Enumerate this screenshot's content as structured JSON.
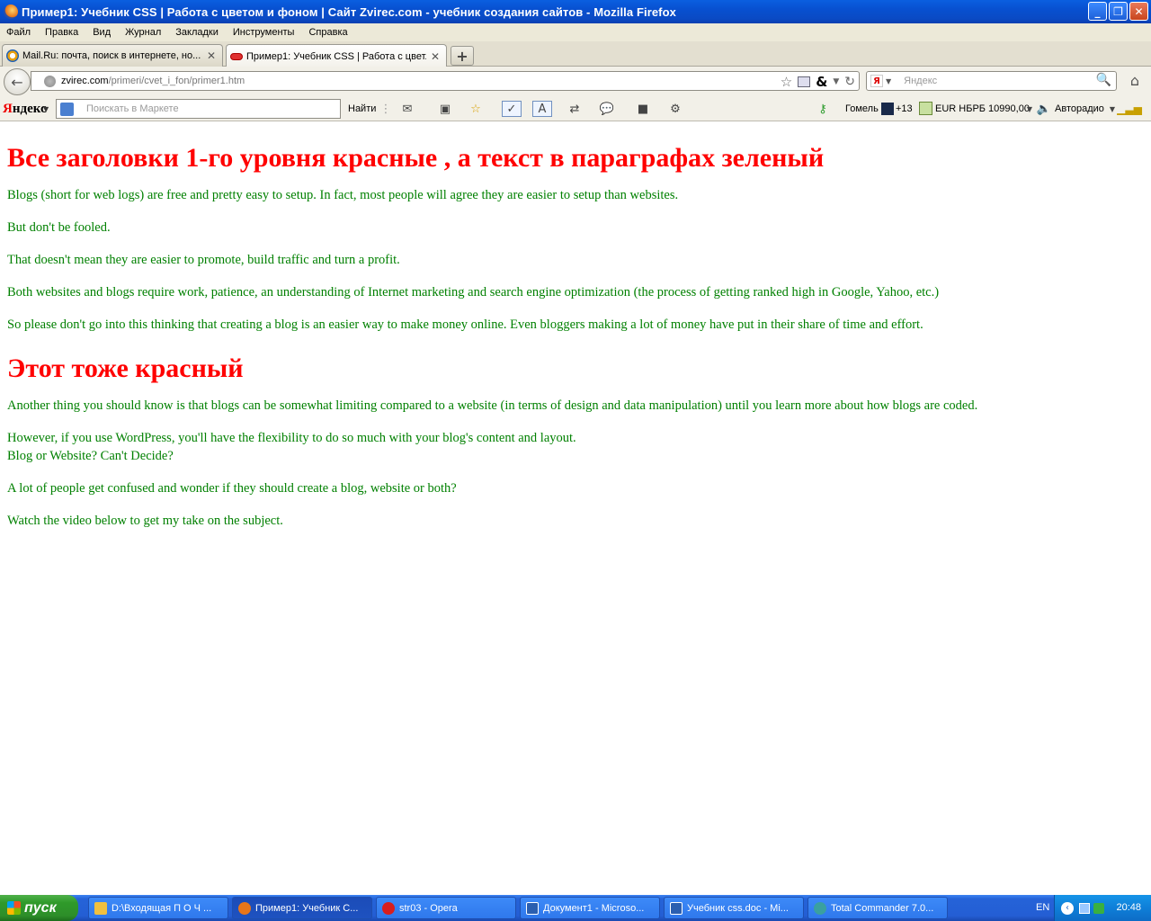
{
  "window": {
    "title": "Пример1: Учебник CSS | Работа с цветом и фоном | Сайт Zvirec.com - учебник создания сайтов - Mozilla Firefox",
    "minimize": "_",
    "restore": "❐",
    "close": "✕"
  },
  "menu": [
    "Файл",
    "Правка",
    "Вид",
    "Журнал",
    "Закладки",
    "Инструменты",
    "Справка"
  ],
  "tabs": [
    {
      "label": "Mail.Ru: почта, поиск в интернете, но...",
      "close": "✕"
    },
    {
      "label": "Пример1: Учебник CSS | Работа с цвет...",
      "close": "✕"
    }
  ],
  "new_tab": "+",
  "nav": {
    "back": "←",
    "url_host": "zvirec.com",
    "url_path": "/primeri/cvet_i_fon/primer1.htm",
    "star": "☆",
    "amp": "&",
    "reload": "↻",
    "search_placeholder": "Яндекс",
    "search_engine_letter": "Я",
    "magnifier": "🔍",
    "home": "⌂"
  },
  "yandex_bar": {
    "logo_y": "Я",
    "logo_rest": "ндекс",
    "market_placeholder": "Поискать в Маркете",
    "find": "Найти",
    "city": "Гомель",
    "weather": "+13",
    "currency": "EUR НБРБ 10990,00",
    "radio": "Авторадио"
  },
  "content": {
    "h1_first": "Все заголовки 1-го уровня красные , а текст в параграфах зеленый",
    "paragraphs_first": [
      "Blogs (short for web logs) are free and pretty easy to setup. In fact, most people will agree they are easier to setup than websites.",
      "But don't be fooled.",
      "That doesn't mean they are easier to promote, build traffic and turn a profit.",
      "Both websites and blogs require work, patience, an understanding of Internet marketing and search engine optimization (the process of getting ranked high in Google, Yahoo, etc.)",
      "So please don't go into this thinking that creating a blog is an easier way to make money online. Even bloggers making a lot of money have put in their share of time and effort."
    ],
    "h1_second": "Этот тоже красный",
    "paragraphs_second": [
      "Another thing you should know is that blogs can be somewhat limiting compared to a website (in terms of design and data manipulation) until you learn more about how blogs are coded.",
      "However, if you use WordPress, you'll have the flexibility to do so much with your blog's content and layout.",
      "Blog or Website? Can't Decide?",
      "A lot of people get confused and wonder if they should create a blog, website or both?",
      "Watch the video below to get my take on the subject."
    ],
    "colors": {
      "heading": "#ff0000",
      "paragraph": "#008000"
    }
  },
  "taskbar": {
    "start": "пуск",
    "tasks": [
      {
        "label": "D:\\Входящая  П О Ч ...",
        "icon_color": "#f0c040"
      },
      {
        "label": "Пример1: Учебник С...",
        "icon_color": "#e8761a"
      },
      {
        "label": "str03 - Opera",
        "icon_color": "#d81e1e"
      },
      {
        "label": "Документ1 - Microso...",
        "icon_color": "#2b5fb0"
      },
      {
        "label": "Учебник css.doc - Mi...",
        "icon_color": "#2b5fb0"
      },
      {
        "label": "Total Commander 7.0...",
        "icon_color": "#3aa0a0"
      }
    ],
    "lang": "EN",
    "clock": "20:48"
  }
}
